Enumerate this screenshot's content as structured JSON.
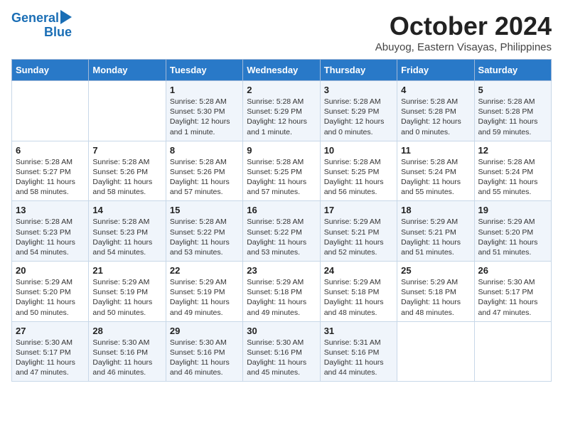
{
  "logo": {
    "line1": "General",
    "line2": "Blue"
  },
  "header": {
    "month": "October 2024",
    "location": "Abuyog, Eastern Visayas, Philippines"
  },
  "days_of_week": [
    "Sunday",
    "Monday",
    "Tuesday",
    "Wednesday",
    "Thursday",
    "Friday",
    "Saturday"
  ],
  "weeks": [
    [
      {
        "num": "",
        "info": ""
      },
      {
        "num": "",
        "info": ""
      },
      {
        "num": "1",
        "info": "Sunrise: 5:28 AM\nSunset: 5:30 PM\nDaylight: 12 hours\nand 1 minute."
      },
      {
        "num": "2",
        "info": "Sunrise: 5:28 AM\nSunset: 5:29 PM\nDaylight: 12 hours\nand 1 minute."
      },
      {
        "num": "3",
        "info": "Sunrise: 5:28 AM\nSunset: 5:29 PM\nDaylight: 12 hours\nand 0 minutes."
      },
      {
        "num": "4",
        "info": "Sunrise: 5:28 AM\nSunset: 5:28 PM\nDaylight: 12 hours\nand 0 minutes."
      },
      {
        "num": "5",
        "info": "Sunrise: 5:28 AM\nSunset: 5:28 PM\nDaylight: 11 hours\nand 59 minutes."
      }
    ],
    [
      {
        "num": "6",
        "info": "Sunrise: 5:28 AM\nSunset: 5:27 PM\nDaylight: 11 hours\nand 58 minutes."
      },
      {
        "num": "7",
        "info": "Sunrise: 5:28 AM\nSunset: 5:26 PM\nDaylight: 11 hours\nand 58 minutes."
      },
      {
        "num": "8",
        "info": "Sunrise: 5:28 AM\nSunset: 5:26 PM\nDaylight: 11 hours\nand 57 minutes."
      },
      {
        "num": "9",
        "info": "Sunrise: 5:28 AM\nSunset: 5:25 PM\nDaylight: 11 hours\nand 57 minutes."
      },
      {
        "num": "10",
        "info": "Sunrise: 5:28 AM\nSunset: 5:25 PM\nDaylight: 11 hours\nand 56 minutes."
      },
      {
        "num": "11",
        "info": "Sunrise: 5:28 AM\nSunset: 5:24 PM\nDaylight: 11 hours\nand 55 minutes."
      },
      {
        "num": "12",
        "info": "Sunrise: 5:28 AM\nSunset: 5:24 PM\nDaylight: 11 hours\nand 55 minutes."
      }
    ],
    [
      {
        "num": "13",
        "info": "Sunrise: 5:28 AM\nSunset: 5:23 PM\nDaylight: 11 hours\nand 54 minutes."
      },
      {
        "num": "14",
        "info": "Sunrise: 5:28 AM\nSunset: 5:23 PM\nDaylight: 11 hours\nand 54 minutes."
      },
      {
        "num": "15",
        "info": "Sunrise: 5:28 AM\nSunset: 5:22 PM\nDaylight: 11 hours\nand 53 minutes."
      },
      {
        "num": "16",
        "info": "Sunrise: 5:28 AM\nSunset: 5:22 PM\nDaylight: 11 hours\nand 53 minutes."
      },
      {
        "num": "17",
        "info": "Sunrise: 5:29 AM\nSunset: 5:21 PM\nDaylight: 11 hours\nand 52 minutes."
      },
      {
        "num": "18",
        "info": "Sunrise: 5:29 AM\nSunset: 5:21 PM\nDaylight: 11 hours\nand 51 minutes."
      },
      {
        "num": "19",
        "info": "Sunrise: 5:29 AM\nSunset: 5:20 PM\nDaylight: 11 hours\nand 51 minutes."
      }
    ],
    [
      {
        "num": "20",
        "info": "Sunrise: 5:29 AM\nSunset: 5:20 PM\nDaylight: 11 hours\nand 50 minutes."
      },
      {
        "num": "21",
        "info": "Sunrise: 5:29 AM\nSunset: 5:19 PM\nDaylight: 11 hours\nand 50 minutes."
      },
      {
        "num": "22",
        "info": "Sunrise: 5:29 AM\nSunset: 5:19 PM\nDaylight: 11 hours\nand 49 minutes."
      },
      {
        "num": "23",
        "info": "Sunrise: 5:29 AM\nSunset: 5:18 PM\nDaylight: 11 hours\nand 49 minutes."
      },
      {
        "num": "24",
        "info": "Sunrise: 5:29 AM\nSunset: 5:18 PM\nDaylight: 11 hours\nand 48 minutes."
      },
      {
        "num": "25",
        "info": "Sunrise: 5:29 AM\nSunset: 5:18 PM\nDaylight: 11 hours\nand 48 minutes."
      },
      {
        "num": "26",
        "info": "Sunrise: 5:30 AM\nSunset: 5:17 PM\nDaylight: 11 hours\nand 47 minutes."
      }
    ],
    [
      {
        "num": "27",
        "info": "Sunrise: 5:30 AM\nSunset: 5:17 PM\nDaylight: 11 hours\nand 47 minutes."
      },
      {
        "num": "28",
        "info": "Sunrise: 5:30 AM\nSunset: 5:16 PM\nDaylight: 11 hours\nand 46 minutes."
      },
      {
        "num": "29",
        "info": "Sunrise: 5:30 AM\nSunset: 5:16 PM\nDaylight: 11 hours\nand 46 minutes."
      },
      {
        "num": "30",
        "info": "Sunrise: 5:30 AM\nSunset: 5:16 PM\nDaylight: 11 hours\nand 45 minutes."
      },
      {
        "num": "31",
        "info": "Sunrise: 5:31 AM\nSunset: 5:16 PM\nDaylight: 11 hours\nand 44 minutes."
      },
      {
        "num": "",
        "info": ""
      },
      {
        "num": "",
        "info": ""
      }
    ]
  ]
}
